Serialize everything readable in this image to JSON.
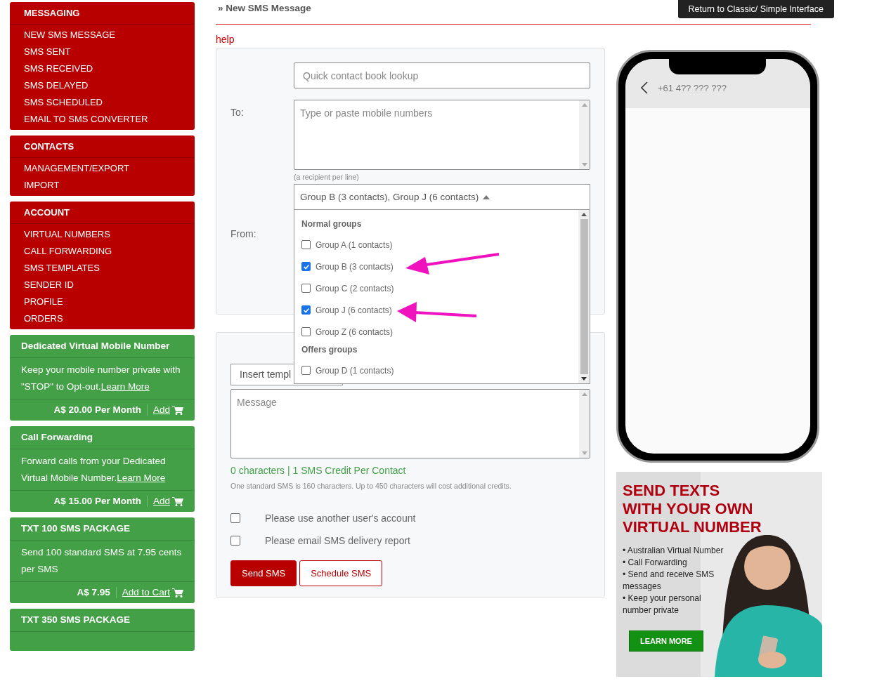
{
  "sidebar": {
    "menus": [
      {
        "title": "MESSAGING",
        "items": [
          "NEW SMS MESSAGE",
          "SMS SENT",
          "SMS RECEIVED",
          "SMS DELAYED",
          "SMS SCHEDULED",
          "EMAIL TO SMS CONVERTER"
        ]
      },
      {
        "title": "CONTACTS",
        "items": [
          "MANAGEMENT/EXPORT",
          "IMPORT"
        ]
      },
      {
        "title": "ACCOUNT",
        "items": [
          "VIRTUAL NUMBERS",
          "CALL FORWARDING",
          "SMS TEMPLATES",
          "SENDER ID",
          "PROFILE",
          "ORDERS"
        ]
      }
    ],
    "offers": [
      {
        "title": "Dedicated Virtual Mobile Number",
        "description": "Keep your mobile number private with \"STOP\" to Opt-out.",
        "link": "Learn More",
        "price": "A$ 20.00 Per Month",
        "action": "Add"
      },
      {
        "title": "Call Forwarding",
        "description": "Forward calls from your Dedicated Virtual Mobile Number.",
        "link": "Learn More",
        "price": "A$ 15.00 Per Month",
        "action": "Add"
      },
      {
        "title": "TXT 100 SMS PACKAGE",
        "description": "Send 100 standard SMS at 7.95 cents per SMS",
        "price": "A$ 7.95",
        "action": "Add to Cart"
      },
      {
        "title": "TXT 350 SMS PACKAGE"
      }
    ]
  },
  "header": {
    "breadcrumb": "» New SMS Message",
    "return_button": "Return to Classic/ Simple Interface"
  },
  "help_link": "help",
  "recipients": {
    "lookup_placeholder": "Quick contact book lookup",
    "to_label": "To:",
    "numbers_placeholder": "Type or paste mobile numbers",
    "hint": "(a recipient per line)",
    "groups_value": "Group B (3 contacts), Group J (6 contacts)",
    "from_label": "From:"
  },
  "groups_dropdown": {
    "sections": [
      {
        "title": "Normal groups",
        "options": [
          {
            "label": "Group A (1 contacts)",
            "checked": false
          },
          {
            "label": "Group B (3 contacts)",
            "checked": true
          },
          {
            "label": "Group C (2 contacts)",
            "checked": false
          },
          {
            "label": "Group J (6 contacts)",
            "checked": true
          },
          {
            "label": "Group Z (6 contacts)",
            "checked": false
          }
        ]
      },
      {
        "title": "Offers groups",
        "options": [
          {
            "label": "Group D (1 contacts)",
            "checked": false
          }
        ]
      }
    ]
  },
  "message": {
    "template_value": "Insert templ",
    "placeholder": "Message",
    "counter": "0 characters | 1 SMS Credit Per Contact",
    "note": "One standard SMS is 160 characters. Up to 450 characters will cost additional credits.",
    "options": [
      {
        "label": "Please use another user's account",
        "checked": false
      },
      {
        "label": "Please email SMS delivery report",
        "checked": false
      }
    ],
    "send_button": "Send SMS",
    "schedule_button": "Schedule SMS"
  },
  "phone": {
    "number": "+61 4?? ??? ???"
  },
  "ad": {
    "headline": [
      "SEND TEXTS",
      "WITH YOUR OWN",
      "VIRTUAL NUMBER"
    ],
    "bullets": [
      "• Australian Virtual Number",
      "• Call Forwarding",
      "• Send and receive SMS messages",
      "• Keep your personal number private"
    ],
    "cta": "LEARN MORE"
  }
}
